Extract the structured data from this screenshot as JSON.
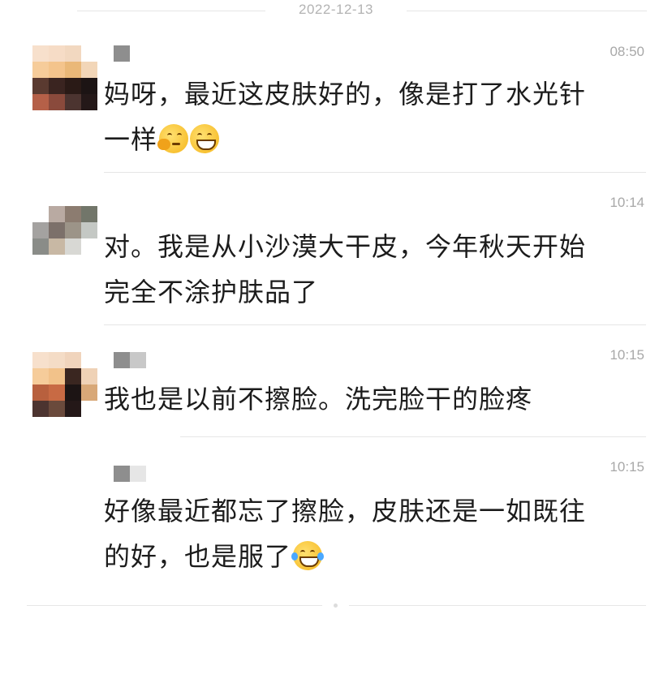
{
  "date_separator": "2022-12-13",
  "messages": [
    {
      "time": "08:50",
      "line1": "妈呀，最近这皮肤好的，像是打了水光针",
      "line2": "一样",
      "emojis": [
        "thinking-face-emoji",
        "grinning-face-emoji"
      ]
    },
    {
      "time": "10:14",
      "line1": "对。我是从小沙漠大干皮，今年秋天开始",
      "line2": "完全不涂护肤品了"
    },
    {
      "time": "10:15",
      "line1": "我也是以前不擦脸。洗完脸干的脸疼"
    },
    {
      "time": "10:15",
      "line1": "好像最近都忘了擦脸，皮肤还是一如既往",
      "line2": "的好，也是服了",
      "emojis": [
        "tears-of-joy-emoji"
      ]
    }
  ],
  "colors": {
    "text": "#1c1c1c",
    "meta": "#a8a8a8",
    "divider": "#e6e6e6",
    "background": "#ffffff"
  }
}
